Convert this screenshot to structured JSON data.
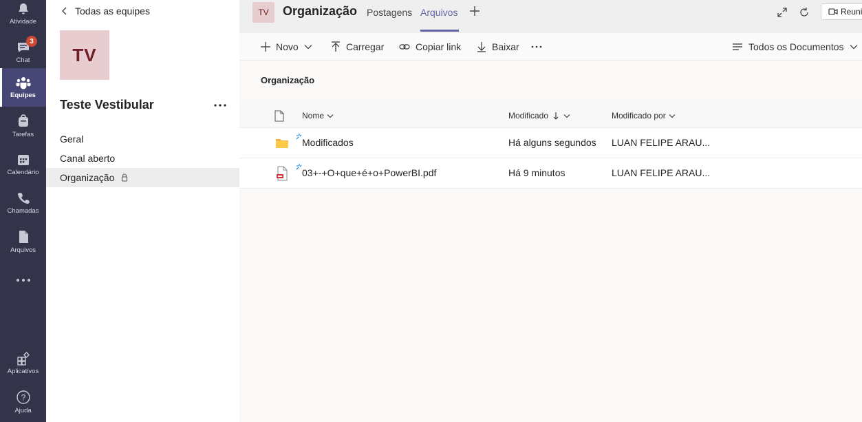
{
  "rail": {
    "items": [
      {
        "label": "Atividade",
        "icon": "bell-icon"
      },
      {
        "label": "Chat",
        "icon": "chat-icon",
        "badge": "3"
      },
      {
        "label": "Equipes",
        "icon": "teams-icon",
        "active": true
      },
      {
        "label": "Tarefas",
        "icon": "bag-icon"
      },
      {
        "label": "Calendário",
        "icon": "calendar-icon"
      },
      {
        "label": "Chamadas",
        "icon": "phone-icon"
      },
      {
        "label": "Arquivos",
        "icon": "file-icon"
      },
      {
        "label": "",
        "icon": "more-icon"
      }
    ],
    "bottom": [
      {
        "label": "Aplicativos",
        "icon": "apps-icon"
      },
      {
        "label": "Ajuda",
        "icon": "help-icon"
      }
    ]
  },
  "panel": {
    "back_label": "Todas as equipes",
    "team_initials": "TV",
    "team_name": "Teste Vestibular",
    "channels": [
      "Geral",
      "Canal aberto",
      "Organização"
    ],
    "selected_channel": "Organização"
  },
  "header": {
    "initials": "TV",
    "title": "Organização",
    "tabs": [
      "Postagens",
      "Arquivos"
    ],
    "active_tab": "Arquivos",
    "meet_label": "Reunir"
  },
  "toolbar": {
    "new_label": "Novo",
    "upload_label": "Carregar",
    "copy_link_label": "Copiar link",
    "download_label": "Baixar",
    "view_label": "Todos os Documentos"
  },
  "content": {
    "breadcrumb": "Organização",
    "columns": {
      "name": "Nome",
      "modified": "Modificado",
      "modified_by": "Modificado por"
    },
    "rows": [
      {
        "type": "folder",
        "name": "Modificados",
        "modified": "Há alguns segundos",
        "modified_by": "LUAN FELIPE ARAU..."
      },
      {
        "type": "pdf",
        "name": "03+-+O+que+é+o+PowerBI.pdf",
        "modified": "Há 9 minutos",
        "modified_by": "LUAN FELIPE ARAU..."
      }
    ]
  },
  "colors": {
    "rail_bg": "#33344a",
    "accent": "#6264a7",
    "avatar_bg": "#e7ccd0",
    "badge": "#cc4a31"
  }
}
